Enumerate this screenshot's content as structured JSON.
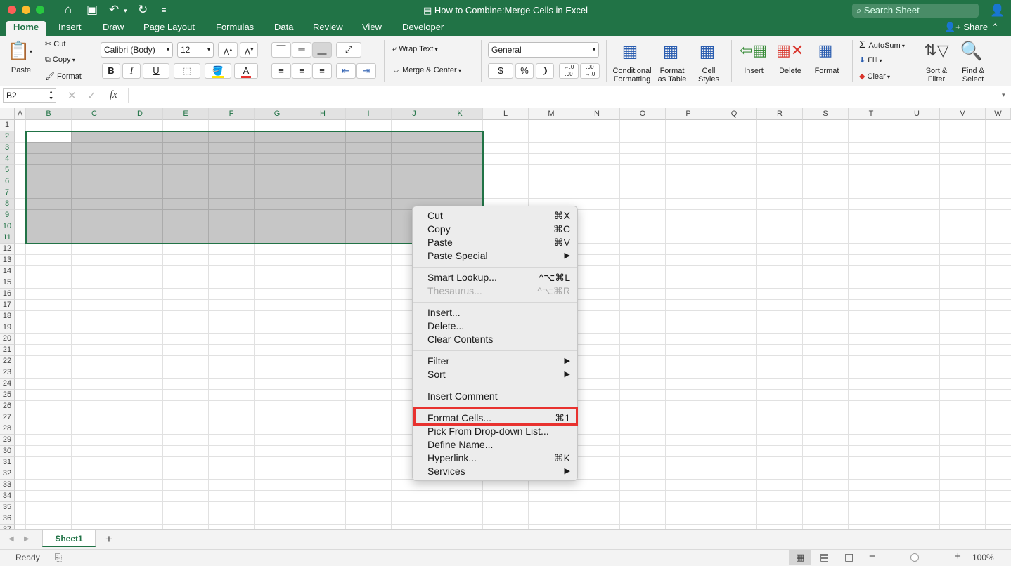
{
  "window": {
    "title": "How to Combine:Merge Cells in Excel",
    "search_placeholder": "Search Sheet",
    "share_label": "Share"
  },
  "tabs": [
    "Home",
    "Insert",
    "Draw",
    "Page Layout",
    "Formulas",
    "Data",
    "Review",
    "View",
    "Developer"
  ],
  "ribbon": {
    "paste": "Paste",
    "cut": "Cut",
    "copy": "Copy",
    "format_painter": "Format",
    "font_name": "Calibri (Body)",
    "font_size": "12",
    "bold": "B",
    "italic": "I",
    "underline": "U",
    "wrap_text": "Wrap Text",
    "merge_center": "Merge & Center",
    "number_format": "General",
    "currency": "$",
    "percent": "%",
    "comma": "❩",
    "cond_format_1": "Conditional",
    "cond_format_2": "Formatting",
    "format_table_1": "Format",
    "format_table_2": "as Table",
    "cell_styles_1": "Cell",
    "cell_styles_2": "Styles",
    "insert": "Insert",
    "delete": "Delete",
    "format": "Format",
    "autosum": "AutoSum",
    "fill": "Fill",
    "clear": "Clear",
    "sort_filter_1": "Sort &",
    "sort_filter_2": "Filter",
    "find_select_1": "Find &",
    "find_select_2": "Select"
  },
  "formula_bar": {
    "name_box": "B2",
    "fx": "fx",
    "formula": ""
  },
  "grid": {
    "columns": [
      "A",
      "B",
      "C",
      "D",
      "E",
      "F",
      "G",
      "H",
      "I",
      "J",
      "K",
      "L",
      "M",
      "N",
      "O",
      "P",
      "Q",
      "R",
      "S",
      "T",
      "U",
      "V",
      "W"
    ],
    "rows": [
      "1",
      "2",
      "3",
      "4",
      "5",
      "6",
      "7",
      "8",
      "9",
      "10",
      "11",
      "12",
      "13",
      "14",
      "15",
      "16",
      "17",
      "18",
      "19",
      "20",
      "21",
      "22",
      "23",
      "24",
      "25",
      "26",
      "27",
      "28",
      "29",
      "30",
      "31",
      "32",
      "33",
      "34",
      "35",
      "36",
      "37"
    ],
    "selection": "B2:K11",
    "active_cell": "B2"
  },
  "context_menu": {
    "items": [
      {
        "label": "Cut",
        "shortcut": "⌘X"
      },
      {
        "label": "Copy",
        "shortcut": "⌘C"
      },
      {
        "label": "Paste",
        "shortcut": "⌘V"
      },
      {
        "label": "Paste Special",
        "shortcut": "▶"
      },
      {
        "label": "Smart Lookup...",
        "shortcut": "^⌥⌘L"
      },
      {
        "label": "Thesaurus...",
        "shortcut": "^⌥⌘R"
      },
      {
        "label": "Insert...",
        "shortcut": ""
      },
      {
        "label": "Delete...",
        "shortcut": ""
      },
      {
        "label": "Clear Contents",
        "shortcut": ""
      },
      {
        "label": "Filter",
        "shortcut": "▶"
      },
      {
        "label": "Sort",
        "shortcut": "▶"
      },
      {
        "label": "Insert Comment",
        "shortcut": ""
      },
      {
        "label": "Format Cells...",
        "shortcut": "⌘1"
      },
      {
        "label": "Pick From Drop-down List...",
        "shortcut": ""
      },
      {
        "label": "Define Name...",
        "shortcut": ""
      },
      {
        "label": "Hyperlink...",
        "shortcut": "⌘K"
      },
      {
        "label": "Services",
        "shortcut": "▶"
      }
    ],
    "highlighted": "Format Cells..."
  },
  "sheets": [
    "Sheet1"
  ],
  "add_sheet": "+",
  "status": {
    "ready": "Ready",
    "zoom": "100%",
    "zoom_minus": "−",
    "zoom_plus": "+"
  },
  "colors": {
    "excel_green": "#217346",
    "selection_fill": "#c6c6c6",
    "highlight_red": "#e8322f"
  }
}
